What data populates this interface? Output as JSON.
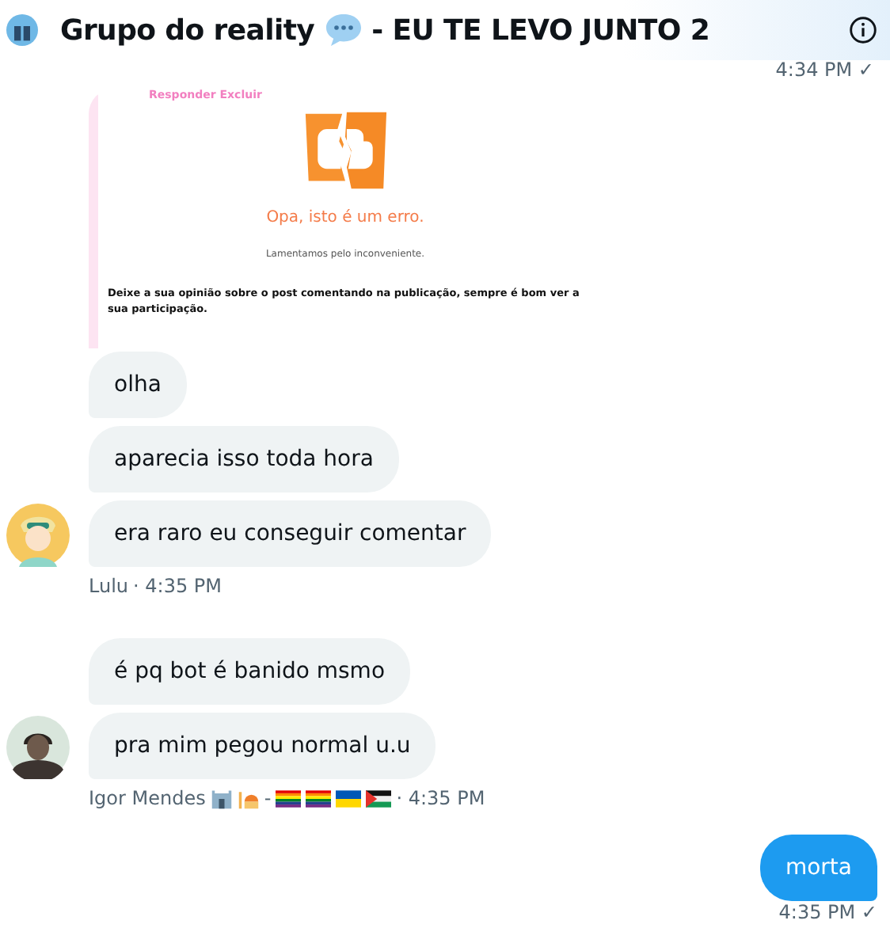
{
  "header": {
    "title": "Grupo do reality",
    "title_rest": "- EU TE LEVO JUNTO 2"
  },
  "top_time": "4:34 PM ✓",
  "shared_image": {
    "kind": "screenshot",
    "links": "Responder Excluir",
    "error_title": "Opa, isto é um erro.",
    "error_sub": "Lamentamos pelo inconveniente.",
    "note": "Deixe a sua opinião sobre o post comentando na publicação, sempre é bom ver a sua participação."
  },
  "groups": [
    {
      "kind": "incoming",
      "avatar": {
        "kind": "blonde"
      },
      "messages": [
        "olha",
        "aparecia isso toda hora",
        "era raro eu conseguir comentar"
      ],
      "sender": "Lulu",
      "time": "· 4:35 PM"
    },
    {
      "kind": "incoming",
      "avatar": {
        "kind": "dark"
      },
      "messages": [
        "é pq bot é banido msmo",
        "pra mim pegou normal u.u"
      ],
      "sender": "Igor Mendes",
      "emblems": [
        {
          "kind": "castle"
        },
        {
          "kind": "mosque"
        },
        {
          "kind": "dash"
        },
        {
          "kind": "rainbow"
        },
        {
          "kind": "rainbow"
        },
        {
          "kind": "ukraine"
        },
        {
          "kind": "palestine"
        }
      ],
      "dash": "-",
      "time": "· 4:35 PM"
    },
    {
      "kind": "outgoing",
      "messages": [
        "morta"
      ],
      "time": "4:35 PM ✓"
    }
  ]
}
